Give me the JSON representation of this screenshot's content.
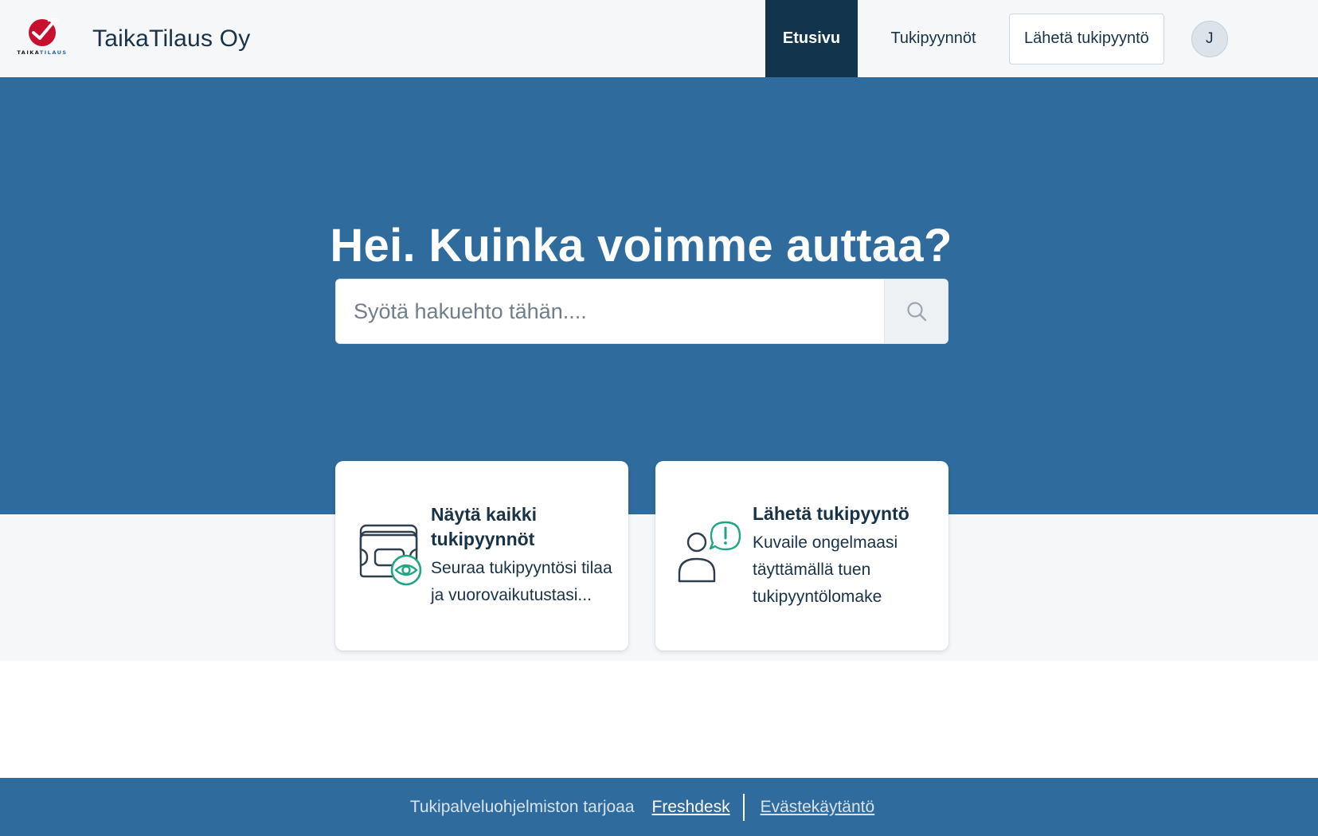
{
  "header": {
    "logo_text_dark": "TAIKA",
    "logo_text_accent": "TILAUS",
    "brand_name": "TaikaTilaus Oy",
    "nav": {
      "home_label": "Etusivu",
      "tickets_label": "Tukipyynnöt",
      "submit_label": "Lähetä tukipyyntö"
    },
    "avatar_initial": "J"
  },
  "hero": {
    "title": "Hei. Kuinka voimme auttaa?",
    "search": {
      "placeholder": "Syötä hakuehto tähän....",
      "value": ""
    }
  },
  "cards": [
    {
      "title": "Näytä kaikki tukipyynnöt",
      "description": "Seuraa tukipyyntösi tilaa ja vuorovaikutustasi...",
      "icon": "tickets-view-icon"
    },
    {
      "title": "Lähetä tukipyyntö",
      "description": "Kuvaile ongelmaasi täyttämällä tuen tukipyyntölomake",
      "icon": "person-alert-icon"
    }
  ],
  "footer": {
    "powered_by_text": "Tukipalveluohjelmiston tarjoaa",
    "freshdesk_link": "Freshdesk",
    "cookie_policy_link": "Evästekäytäntö"
  },
  "colors": {
    "brand_blue": "#2f6b9d",
    "nav_active": "#12344d",
    "accent_green": "#1fa685",
    "logo_red": "#c8102e"
  }
}
